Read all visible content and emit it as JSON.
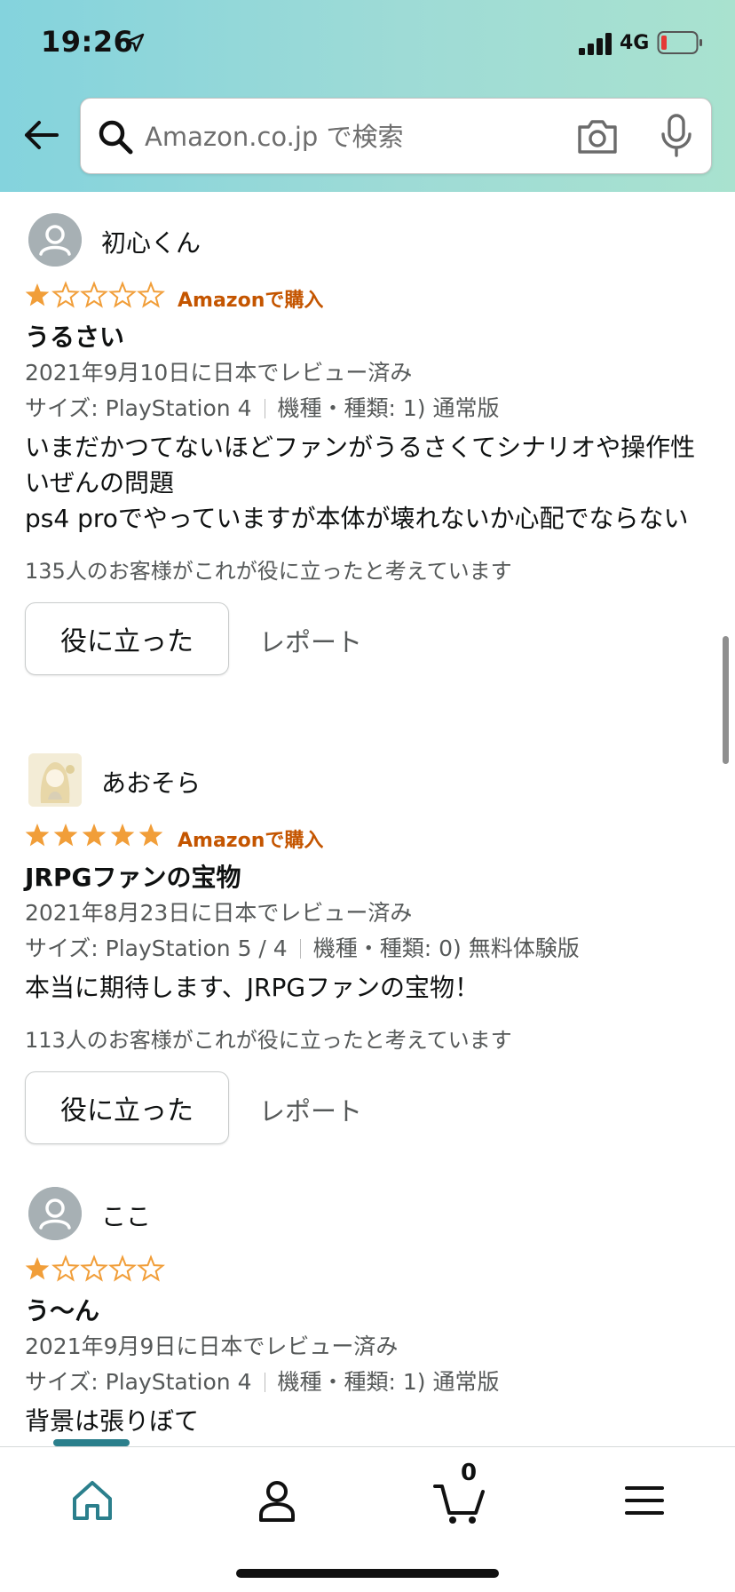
{
  "status_bar": {
    "time": "19:26",
    "network": "4G"
  },
  "search": {
    "placeholder": "Amazon.co.jp で検索"
  },
  "reviews": [
    {
      "name": "初心くん",
      "stars": 1,
      "verified": "Amazonで購入",
      "title": "うるさい",
      "date": "2021年9月10日に日本でレビュー済み",
      "size": "サイズ: PlayStation 4",
      "edition": "機種・種類: 1) 通常版",
      "body": "いまだかつてないほどファンがうるさくてシナリオや操作性いぜんの問題\nps4 proでやっていますが本体が壊れないか心配でならない",
      "helpful": "135人のお客様がこれが役に立ったと考えています",
      "helpful_button": "役に立った",
      "report": "レポート"
    },
    {
      "name": "あおそら",
      "stars": 5,
      "verified": "Amazonで購入",
      "title": "JRPGファンの宝物",
      "date": "2021年8月23日に日本でレビュー済み",
      "size": "サイズ: PlayStation 5 / 4",
      "edition": "機種・種類: 0) 無料体験版",
      "body": "本当に期待します、JRPGファンの宝物！",
      "helpful": "113人のお客様がこれが役に立ったと考えています",
      "helpful_button": "役に立った",
      "report": "レポート"
    },
    {
      "name": "ここ",
      "stars": 1,
      "verified": "",
      "title": "う〜ん",
      "date": "2021年9月9日に日本でレビュー済み",
      "size": "サイズ: PlayStation 4",
      "edition": "機種・種類: 1) 通常版",
      "body": "背景は張りぼて"
    }
  ],
  "cart": {
    "count": "0"
  },
  "colors": {
    "accent": "#2b7f8c",
    "star": "#f19e39",
    "verified": "#c45500"
  }
}
